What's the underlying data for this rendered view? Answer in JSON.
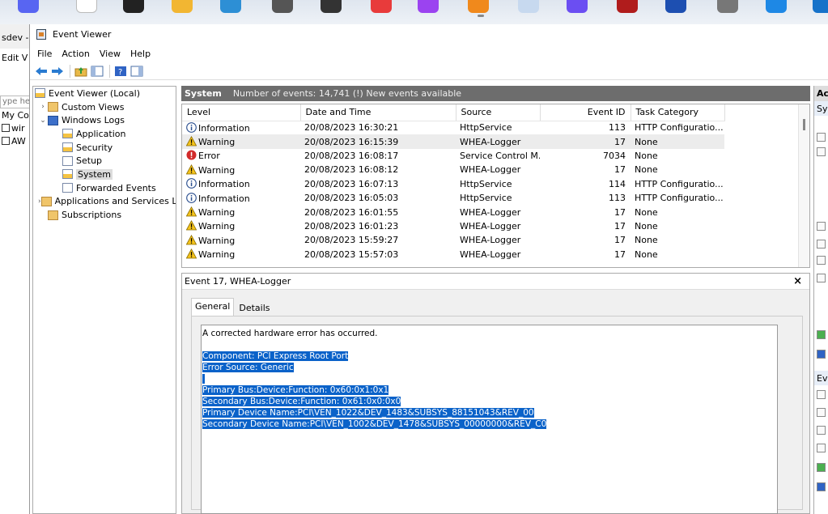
{
  "taskbar": {
    "icons": [
      {
        "name": "discord-icon",
        "color": "#5865f2"
      },
      {
        "name": "blank-app-icon",
        "color": "#ffffff"
      },
      {
        "name": "sticky-notes-icon",
        "color": "#222222"
      },
      {
        "name": "file-explorer-icon",
        "color": "#f2b632"
      },
      {
        "name": "app-icon",
        "color": "#2d8fd5"
      },
      {
        "name": "game-icon",
        "color": "#555555"
      },
      {
        "name": "notepad-icon",
        "color": "#333333"
      },
      {
        "name": "red-app-icon",
        "color": "#e83b3b"
      },
      {
        "name": "purple-app-icon",
        "color": "#9b43f0"
      },
      {
        "name": "event-viewer-taskbar-icon",
        "color": "#f0891c"
      },
      {
        "name": "window-app-icon",
        "color": "#c7d9ef"
      },
      {
        "name": "browser-icon",
        "color": "#6b4ef2"
      },
      {
        "name": "dark-red-app-icon",
        "color": "#b01c1c"
      },
      {
        "name": "store-icon",
        "color": "#1d4fb1"
      },
      {
        "name": "settings-icon",
        "color": "#777777"
      },
      {
        "name": "blue-circle-app-icon",
        "color": "#1e88e5"
      },
      {
        "name": "edge-icon",
        "color": "#1672c9"
      }
    ]
  },
  "bg_window": {
    "title": "sdev - V",
    "menu": "Edit  V",
    "search_placeholder": "ype her",
    "items": [
      "My Co",
      "wir",
      "AW"
    ]
  },
  "window": {
    "title": "Event Viewer",
    "menu": [
      "File",
      "Action",
      "View",
      "Help"
    ]
  },
  "tree": {
    "items": [
      {
        "label": "Event Viewer (Local)",
        "indent": 0,
        "arrow": "",
        "icon": "log y"
      },
      {
        "label": "Custom Views",
        "indent": 1,
        "arrow": "›",
        "icon": "folder"
      },
      {
        "label": "Windows Logs",
        "indent": 1,
        "arrow": "⌄",
        "icon": "blue"
      },
      {
        "label": "Application",
        "indent": 2,
        "arrow": "",
        "icon": "log y"
      },
      {
        "label": "Security",
        "indent": 2,
        "arrow": "",
        "icon": "log y"
      },
      {
        "label": "Setup",
        "indent": 2,
        "arrow": "",
        "icon": "log"
      },
      {
        "label": "System",
        "indent": 2,
        "arrow": "",
        "icon": "log y",
        "selected": true
      },
      {
        "label": "Forwarded Events",
        "indent": 2,
        "arrow": "",
        "icon": "log"
      },
      {
        "label": "Applications and Services Lo",
        "indent": 1,
        "arrow": "›",
        "icon": "folder"
      },
      {
        "label": "Subscriptions",
        "indent": 1,
        "arrow": "",
        "icon": "folder"
      }
    ]
  },
  "pane": {
    "log_name": "System",
    "info": "Number of events: 14,741 (!) New events available"
  },
  "columns": [
    "Level",
    "Date and Time",
    "Source",
    "Event ID",
    "Task Category"
  ],
  "events": [
    {
      "level": "Information",
      "type": "info",
      "datetime": "20/08/2023 16:30:21",
      "source": "HttpService",
      "id": "113",
      "category": "HTTP Configuratio..."
    },
    {
      "level": "Warning",
      "type": "warn",
      "datetime": "20/08/2023 16:15:39",
      "source": "WHEA-Logger",
      "id": "17",
      "category": "None",
      "selected": true
    },
    {
      "level": "Error",
      "type": "error",
      "datetime": "20/08/2023 16:08:17",
      "source": "Service Control M...",
      "id": "7034",
      "category": "None"
    },
    {
      "level": "Warning",
      "type": "warn",
      "datetime": "20/08/2023 16:08:12",
      "source": "WHEA-Logger",
      "id": "17",
      "category": "None"
    },
    {
      "level": "Information",
      "type": "info",
      "datetime": "20/08/2023 16:07:13",
      "source": "HttpService",
      "id": "114",
      "category": "HTTP Configuratio..."
    },
    {
      "level": "Information",
      "type": "info",
      "datetime": "20/08/2023 16:05:03",
      "source": "HttpService",
      "id": "113",
      "category": "HTTP Configuratio..."
    },
    {
      "level": "Warning",
      "type": "warn",
      "datetime": "20/08/2023 16:01:55",
      "source": "WHEA-Logger",
      "id": "17",
      "category": "None"
    },
    {
      "level": "Warning",
      "type": "warn",
      "datetime": "20/08/2023 16:01:23",
      "source": "WHEA-Logger",
      "id": "17",
      "category": "None"
    },
    {
      "level": "Warning",
      "type": "warn",
      "datetime": "20/08/2023 15:59:27",
      "source": "WHEA-Logger",
      "id": "17",
      "category": "None"
    },
    {
      "level": "Warning",
      "type": "warn",
      "datetime": "20/08/2023 15:57:03",
      "source": "WHEA-Logger",
      "id": "17",
      "category": "None"
    }
  ],
  "detail": {
    "title": "Event 17, WHEA-Logger",
    "close": "×",
    "tabs": [
      "General",
      "Details"
    ],
    "first_line": "A corrected hardware error has occurred.",
    "highlighted_lines": [
      "Component: PCI Express Root Port",
      "Error Source: Generic",
      " ",
      "Primary Bus:Device:Function: 0x60:0x1:0x1",
      "Secondary Bus:Device:Function: 0x61:0x0:0x0",
      "Primary Device Name:PCI\\VEN_1022&DEV_1483&SUBSYS_88151043&REV_00",
      "Secondary Device Name:PCI\\VEN_1002&DEV_1478&SUBSYS_00000000&REV_C0"
    ]
  },
  "actions": {
    "header": "Ac",
    "sub1": "Sy",
    "sub2": "Ev"
  }
}
